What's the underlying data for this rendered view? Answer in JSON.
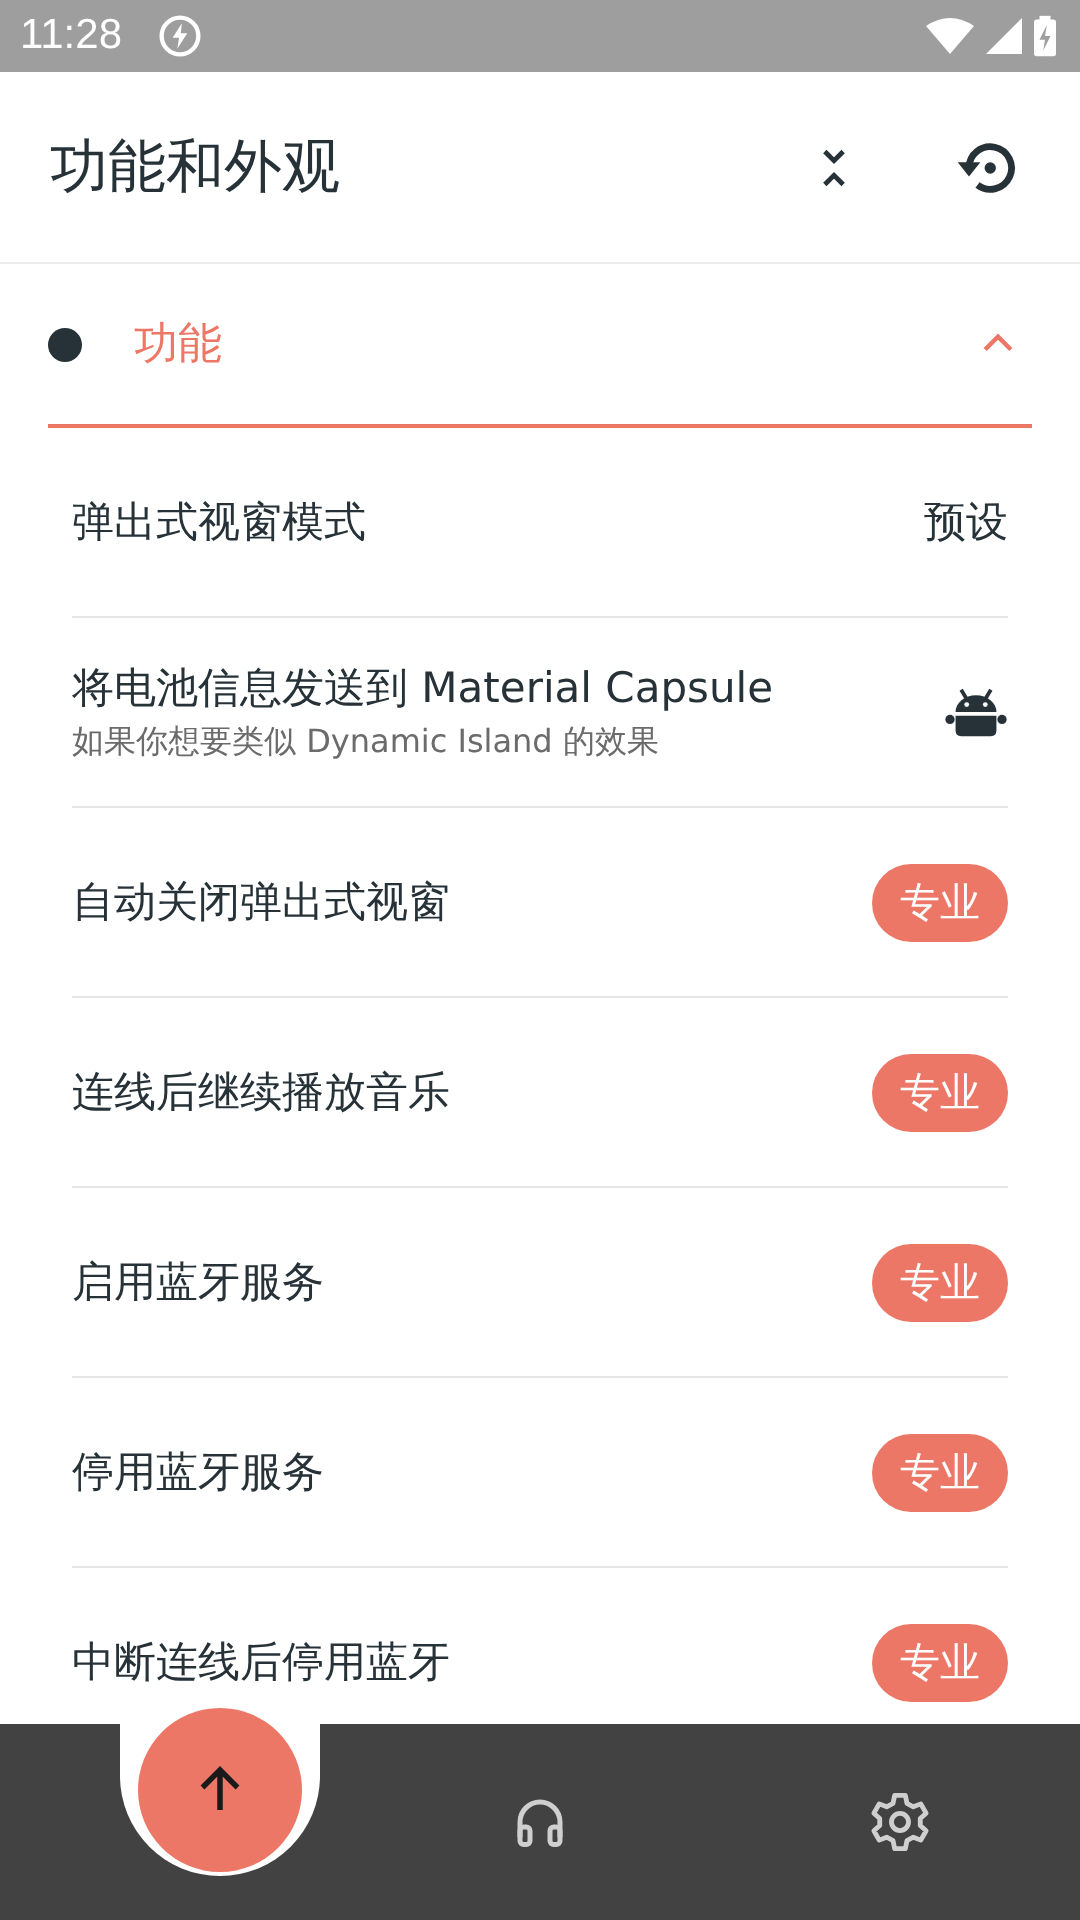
{
  "status_bar": {
    "time": "11:28"
  },
  "app_bar": {
    "title": "功能和外观"
  },
  "section": {
    "title": "功能",
    "expanded": true
  },
  "rows": [
    {
      "kind": "value",
      "title": "弹出式视窗模式",
      "value": "预设"
    },
    {
      "kind": "icon",
      "title": "将电池信息发送到 Material Capsule",
      "subtitle": "如果你想要类似 Dynamic Island 的效果"
    },
    {
      "kind": "pro",
      "title": "自动关闭弹出式视窗",
      "badge": "专业"
    },
    {
      "kind": "pro",
      "title": "连线后继续播放音乐",
      "badge": "专业"
    },
    {
      "kind": "pro",
      "title": "启用蓝牙服务",
      "badge": "专业"
    },
    {
      "kind": "pro",
      "title": "停用蓝牙服务",
      "badge": "专业"
    },
    {
      "kind": "pro",
      "title": "中断连线后停用蓝牙",
      "badge": "专业"
    }
  ]
}
